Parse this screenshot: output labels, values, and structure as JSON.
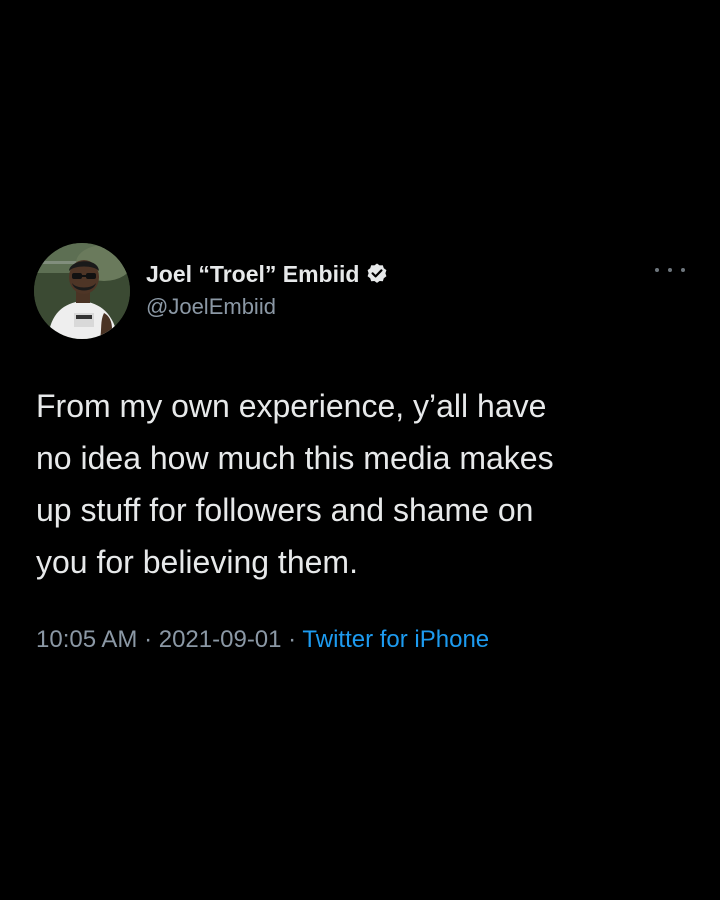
{
  "author": {
    "display_name": "Joel “Troel” Embiid",
    "handle": "@JoelEmbiid",
    "verified": true
  },
  "tweet": {
    "lines": [
      "From my own experience, y’all have",
      "no idea how much this media makes",
      "up stuff for followers and shame on",
      "you for believing them."
    ]
  },
  "meta": {
    "time": "10:05 AM",
    "separator_1": " · ",
    "date": "2021-09-01",
    "separator_2": " · ",
    "source": "Twitter for iPhone"
  },
  "icons": {
    "verified": "verified-badge-icon",
    "more": "more-options-icon"
  },
  "colors": {
    "background": "#000000",
    "primary_text": "#e7e9ea",
    "secondary_text": "#8b98a5",
    "link": "#1d9bf0"
  }
}
